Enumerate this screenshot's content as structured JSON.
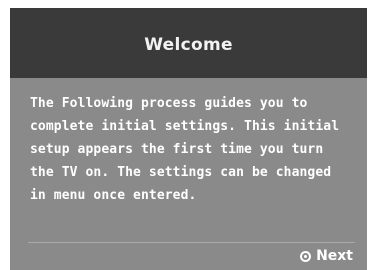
{
  "dialog": {
    "title": "Welcome",
    "message": "The Following process guides you to\ncomplete initial settings. This initial\nsetup appears the first time you turn\nthe TV on. The settings can be changed\nin menu once entered.",
    "next_label": "Next",
    "next_icon": "enter-button-icon"
  }
}
